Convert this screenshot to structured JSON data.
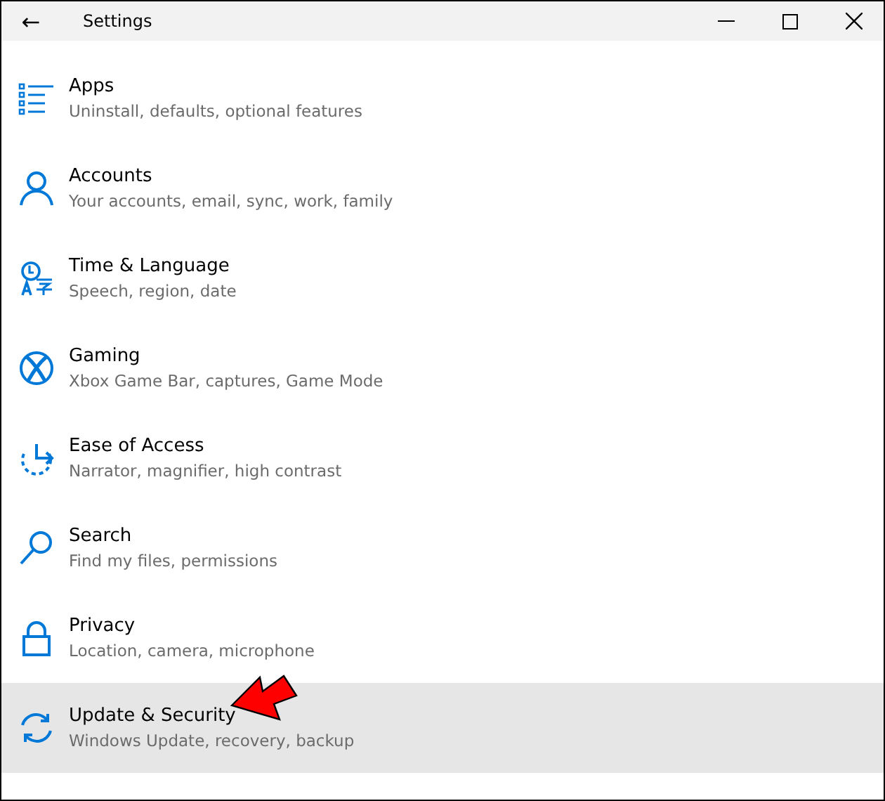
{
  "window": {
    "title": "Settings",
    "back": "←"
  },
  "items": [
    {
      "title": "Apps",
      "subtitle": "Uninstall, defaults, optional features",
      "selected": false
    },
    {
      "title": "Accounts",
      "subtitle": "Your accounts, email, sync, work, family",
      "selected": false
    },
    {
      "title": "Time & Language",
      "subtitle": "Speech, region, date",
      "selected": false
    },
    {
      "title": "Gaming",
      "subtitle": "Xbox Game Bar, captures, Game Mode",
      "selected": false
    },
    {
      "title": "Ease of Access",
      "subtitle": "Narrator, magnifier, high contrast",
      "selected": false
    },
    {
      "title": "Search",
      "subtitle": "Find my files, permissions",
      "selected": false
    },
    {
      "title": "Privacy",
      "subtitle": "Location, camera, microphone",
      "selected": false
    },
    {
      "title": "Update & Security",
      "subtitle": "Windows Update, recovery, backup",
      "selected": true
    }
  ]
}
